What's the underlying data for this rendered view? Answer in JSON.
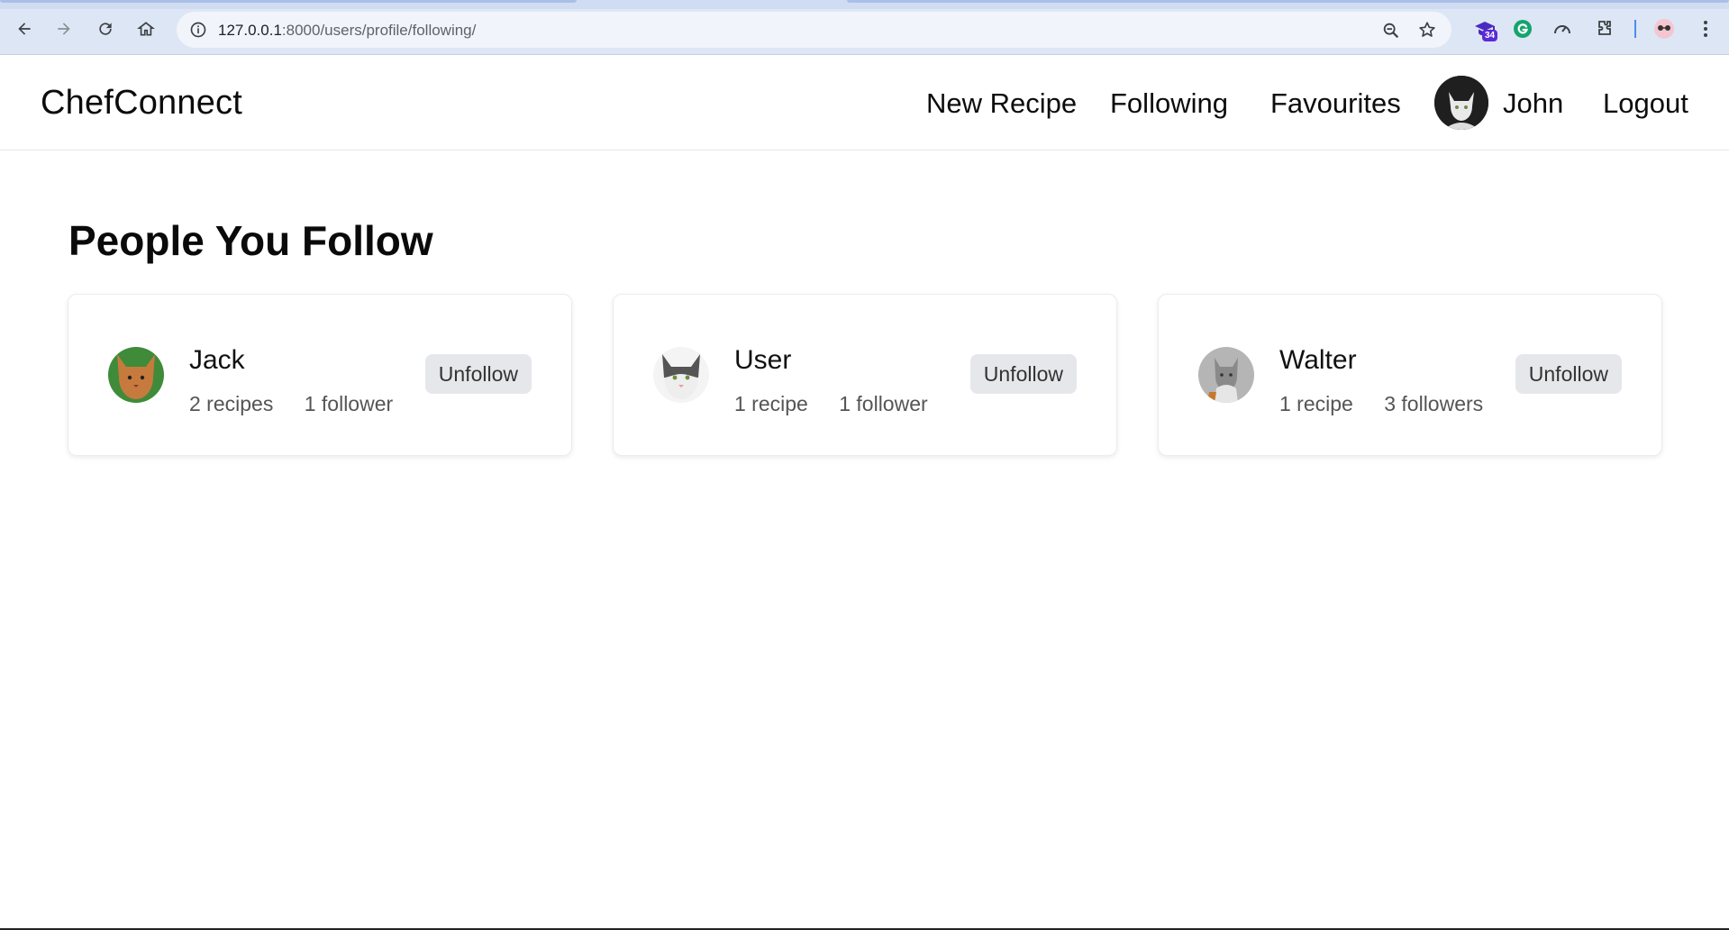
{
  "browser": {
    "url_host": "127.0.0.1",
    "url_path": ":8000/users/profile/following/",
    "extension_badge": "34"
  },
  "app": {
    "brand": "ChefConnect",
    "nav": {
      "new_recipe": "New Recipe",
      "following": "Following",
      "favourites": "Favourites",
      "user_name": "John",
      "logout": "Logout"
    }
  },
  "main": {
    "title": "People You Follow",
    "following": [
      {
        "name": "Jack",
        "recipes": "2 recipes",
        "followers": "1 follower",
        "action": "Unfollow"
      },
      {
        "name": "User",
        "recipes": "1 recipe",
        "followers": "1 follower",
        "action": "Unfollow"
      },
      {
        "name": "Walter",
        "recipes": "1 recipe",
        "followers": "3 followers",
        "action": "Unfollow"
      }
    ]
  },
  "colors": {
    "chrome_bg": "#dde6f5",
    "button_bg": "#e5e7eb",
    "text_primary": "#111111",
    "text_muted": "#555555"
  }
}
